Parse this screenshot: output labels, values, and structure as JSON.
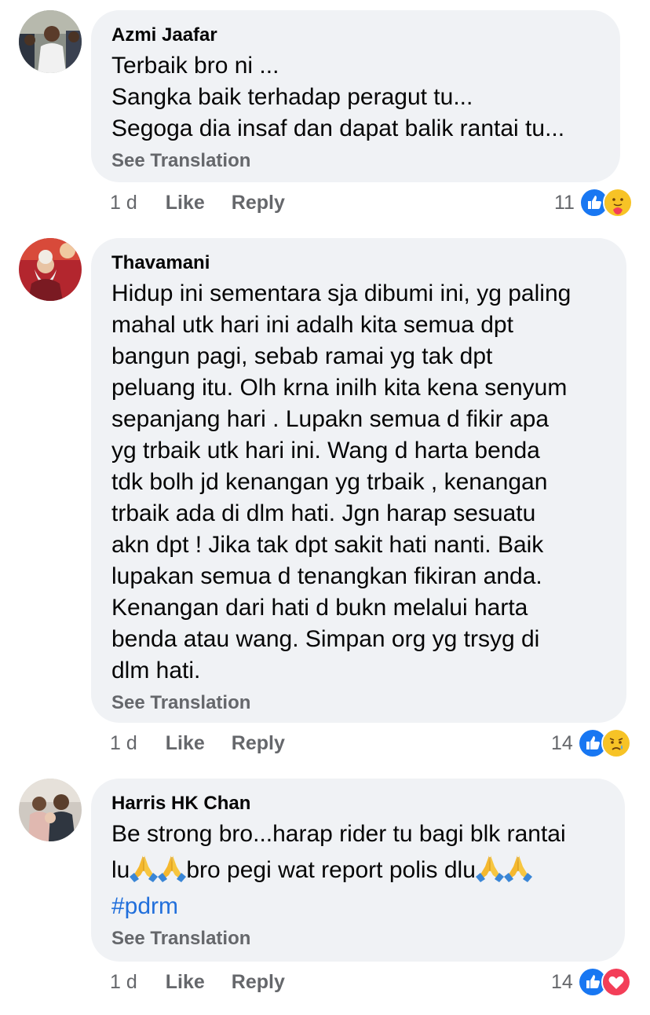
{
  "comments": [
    {
      "author": "Azmi Jaafar",
      "lines": [
        "Terbaik bro ni ...",
        "Sangka baik terhadap peragut tu...",
        "Segoga dia insaf dan dapat balik rantai tu..."
      ],
      "see_translation": "See Translation",
      "time": "1 d",
      "like_label": "Like",
      "reply_label": "Reply",
      "reaction_count": "11",
      "reaction_icons": [
        "like-icon",
        "care-icon"
      ]
    },
    {
      "author": "Thavamani",
      "lines": [
        "Hidup ini sementara sja dibumi ini, yg paling",
        "mahal utk hari ini adalh kita semua dpt",
        "bangun pagi, sebab ramai yg tak dpt",
        "peluang itu. Olh krna inilh kita kena senyum",
        "sepanjang hari . Lupakn semua d fikir apa",
        "yg trbaik utk hari ini. Wang d harta benda",
        "tdk bolh jd kenangan yg trbaik , kenangan",
        "trbaik ada di dlm hati. Jgn harap sesuatu",
        "akn dpt ! Jika tak dpt sakit hati nanti. Baik",
        "lupakan semua d tenangkan fikiran anda.",
        "Kenangan dari hati d bukn melalui harta",
        "benda atau wang. Simpan org yg trsyg di",
        "dlm hati."
      ],
      "see_translation": "See Translation",
      "time": "1 d",
      "like_label": "Like",
      "reply_label": "Reply",
      "reaction_count": "14",
      "reaction_icons": [
        "like-icon",
        "sad-icon"
      ]
    },
    {
      "author": "Harris HK Chan",
      "line1": "Be strong bro...harap rider tu bagi blk rantai",
      "line2_part1": "lu",
      "line2_part2": "bro pegi wat report polis dlu",
      "hashtag": "#pdrm",
      "see_translation": "See Translation",
      "time": "1 d",
      "like_label": "Like",
      "reply_label": "Reply",
      "reaction_count": "14",
      "reaction_icons": [
        "like-icon",
        "love-icon"
      ]
    }
  ],
  "colors": {
    "bubble_bg": "#f0f2f5",
    "secondary_text": "#65676b",
    "like_blue": "#1877f2",
    "hashtag_blue": "#216fdb",
    "love_red": "#f33e58",
    "emoji_yellow": "#f7c326"
  }
}
